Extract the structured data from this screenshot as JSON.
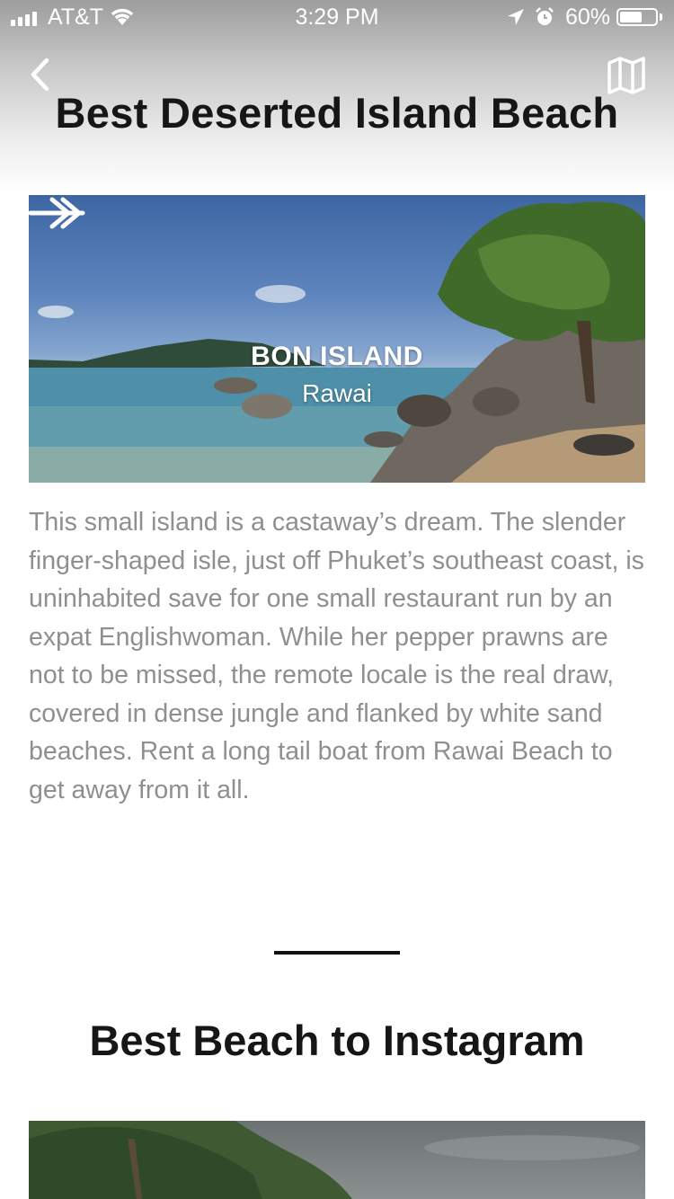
{
  "status_bar": {
    "carrier": "AT&T",
    "time": "3:29 PM",
    "battery": "60%"
  },
  "nav": {
    "back_icon": "chevron-left-icon",
    "map_icon": "map-icon"
  },
  "page": {
    "title": "Best Deserted Island Beach"
  },
  "featured": {
    "name": "BON ISLAND",
    "area": "Rawai",
    "arrow_icon": "double-arrow-right-icon",
    "description": "This small island is a castaway’s dream. The slender finger-shaped isle, just off Phuket’s southeast coast, is uninhabited save for one small restaurant run by an expat Englishwoman. While her pepper prawns are not to be missed, the remote locale is the real draw, covered in dense jungle and flanked by white sand beaches. Rent a long tail boat from Rawai Beach to get away from it all."
  },
  "next_section": {
    "title": "Best Beach to Instagram"
  }
}
